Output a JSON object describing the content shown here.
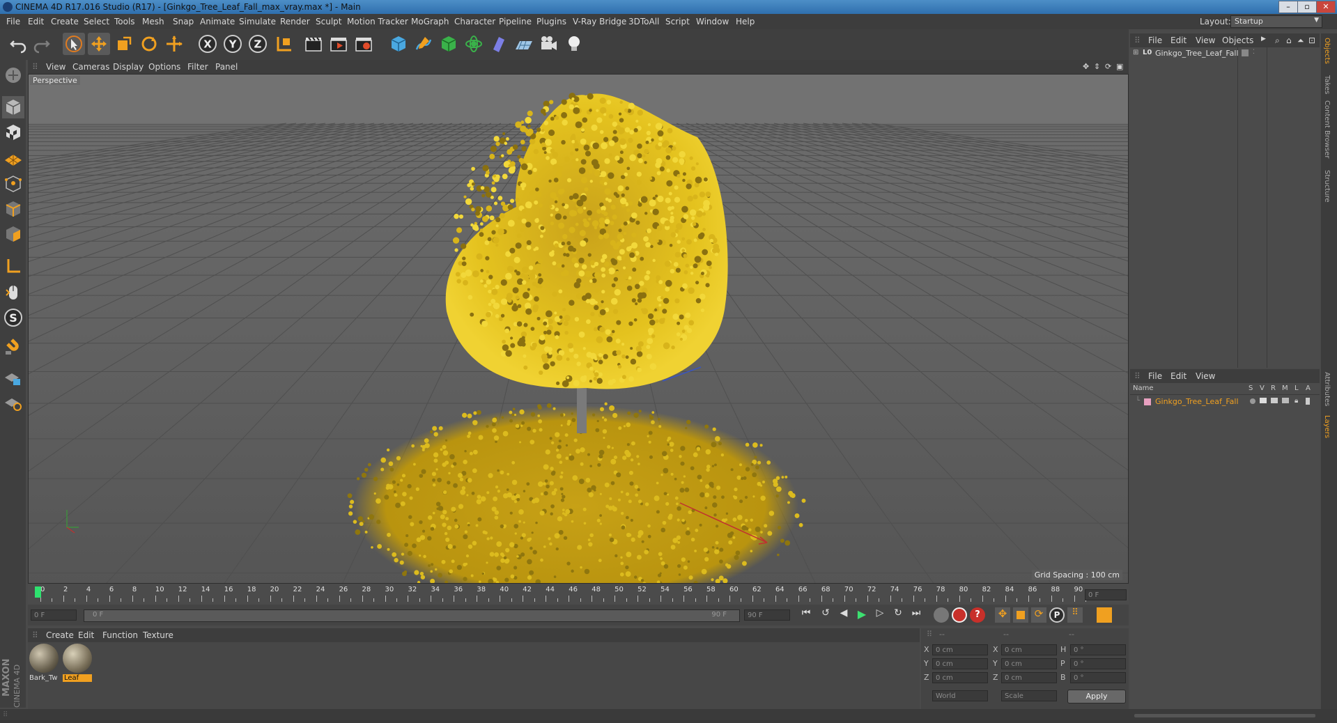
{
  "window": {
    "title": "CINEMA 4D R17.016 Studio (R17) - [Ginkgo_Tree_Leaf_Fall_max_vray.max *] - Main",
    "controls": [
      "–",
      "▫",
      "✕"
    ]
  },
  "menubar": {
    "items": [
      "File",
      "Edit",
      "Create",
      "Select",
      "Tools",
      "Mesh",
      "Snap",
      "Animate",
      "Simulate",
      "Render",
      "Sculpt",
      "Motion Tracker",
      "MoGraph",
      "Character",
      "Pipeline",
      "Plugins",
      "V-Ray Bridge",
      "3DToAll",
      "Script",
      "Window",
      "Help"
    ],
    "layout_label": "Layout:",
    "layout_value": "Startup"
  },
  "toolbar": {
    "axis_x": "X",
    "axis_y": "Y",
    "axis_z": "Z"
  },
  "viewport": {
    "menu": [
      "View",
      "Cameras",
      "Display",
      "Options",
      "Filter",
      "Panel"
    ],
    "camera_label": "Perspective",
    "grid_spacing": "Grid Spacing : 100 cm"
  },
  "timeline": {
    "ticks": [
      "0",
      "2",
      "4",
      "6",
      "8",
      "10",
      "12",
      "14",
      "16",
      "18",
      "20",
      "22",
      "24",
      "26",
      "28",
      "30",
      "32",
      "34",
      "36",
      "38",
      "40",
      "42",
      "44",
      "46",
      "48",
      "50",
      "52",
      "54",
      "56",
      "58",
      "60",
      "62",
      "64",
      "66",
      "68",
      "70",
      "72",
      "74",
      "76",
      "78",
      "80",
      "82",
      "84",
      "86",
      "88",
      "90"
    ],
    "current_frame": "0 F",
    "start_field": "0 F",
    "range_start": "0 F",
    "range_end": "90 F",
    "end_field": "90 F"
  },
  "materials": {
    "menu": [
      "Create",
      "Edit",
      "Function",
      "Texture"
    ],
    "items": [
      {
        "label": "Bark_Tw",
        "selected": false
      },
      {
        "label": "Leaf",
        "selected": true
      }
    ],
    "brand_line1": "MAXON",
    "brand_line2": "CINEMA 4D"
  },
  "coordinates": {
    "header": [
      "--",
      "--",
      "--"
    ],
    "rows": [
      {
        "a_label": "X",
        "a_val": "0 cm",
        "b_label": "X",
        "b_val": "0 cm",
        "c_label": "H",
        "c_val": "0 °"
      },
      {
        "a_label": "Y",
        "a_val": "0 cm",
        "b_label": "Y",
        "b_val": "0 cm",
        "c_label": "P",
        "c_val": "0 °"
      },
      {
        "a_label": "Z",
        "a_val": "0 cm",
        "b_label": "Z",
        "b_val": "0 cm",
        "c_label": "B",
        "c_val": "0 °"
      }
    ],
    "mode1": "World",
    "mode2": "Scale",
    "apply": "Apply"
  },
  "objects_panel": {
    "menu": [
      "File",
      "Edit",
      "View",
      "Objects"
    ],
    "object_name": "Ginkgo_Tree_Leaf_Fall"
  },
  "layers_panel": {
    "menu": [
      "File",
      "Edit",
      "View"
    ],
    "col_name": "Name",
    "cols": [
      "S",
      "V",
      "R",
      "M",
      "L",
      "A"
    ],
    "layer_name": "Ginkgo_Tree_Leaf_Fall",
    "layer_color": "#e8a0c0"
  },
  "right_tabs": [
    "Objects",
    "Takes",
    "Content Browser",
    "Structure",
    "Attributes",
    "Layers"
  ],
  "colors": {
    "accent": "#f0a020",
    "leaf": "#d9b21a",
    "selected_text": "#f0a020"
  }
}
